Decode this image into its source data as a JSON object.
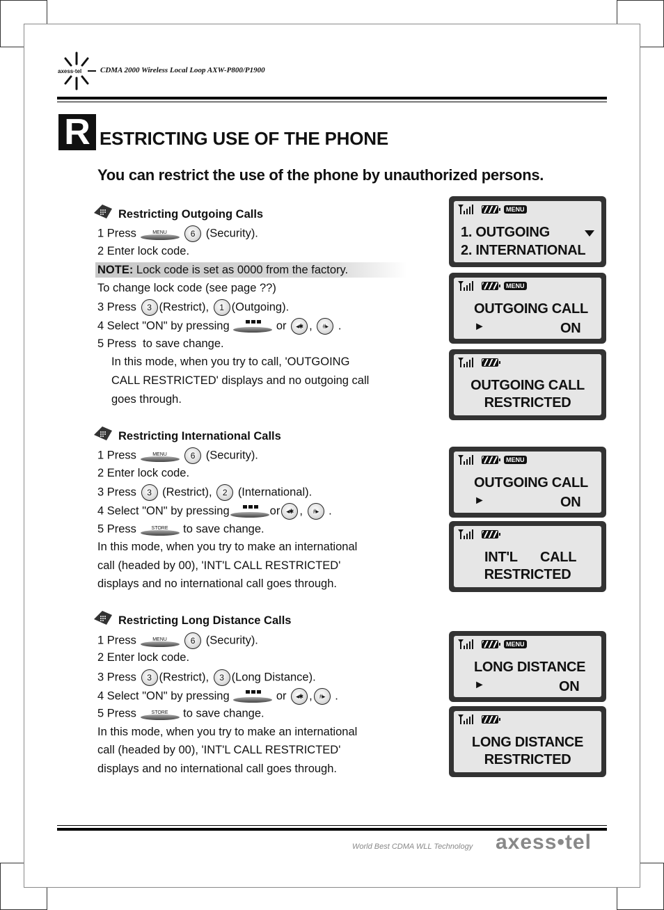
{
  "header": {
    "logo_text": "axess-tel",
    "document_title": "CDMA 2000 Wireless Local Loop AXW-P800/P1900"
  },
  "page": {
    "drop_cap": "R",
    "title_rest": "ESTRICTING USE OF THE PHONE",
    "subtitle": "You can restrict the use of the phone by unauthorized persons."
  },
  "sections": [
    {
      "title": "Restricting Outgoing Calls",
      "step1": {
        "prefix": "1 Press",
        "key_label": "MENU",
        "digit": "6",
        "suffix": "(Security)."
      },
      "step2": "2 Enter lock code.",
      "note": {
        "label": "NOTE:",
        "text": " Lock code is set as 0000 from the factory."
      },
      "change_code": "To change lock code (see page ??)",
      "step3": {
        "prefix": "3 Press",
        "digit1": "3",
        "mid": "(Restrict),",
        "digit2": "1",
        "suffix": "(Outgoing)."
      },
      "step4": {
        "prefix": "4 Select \"ON\" by pressing",
        "or": "or",
        "comma": ",",
        "left_key": "◂✱",
        "right_key": "#▸",
        "end": "."
      },
      "step5": {
        "prefix": "5 Press",
        "key_label": "",
        "suffix": "to save change."
      },
      "desc": [
        "In this mode, when you try to call, 'OUTGOING",
        "CALL RESTRICTED' displays and no outgoing call",
        "goes through."
      ]
    },
    {
      "title": "Restricting International Calls",
      "step1": {
        "prefix": "1 Press",
        "key_label": "MENU",
        "digit": "6",
        "suffix": "(Security)."
      },
      "step2": "2 Enter lock code.",
      "step3": {
        "prefix": "3 Press",
        "digit1": "3",
        "mid": "(Restrict),",
        "digit2": "2",
        "suffix": "(International)."
      },
      "step4": {
        "prefix": "4 Select \"ON\" by pressing",
        "or": "or",
        "comma": ",",
        "left_key": "◂✱",
        "right_key": "#▸",
        "end": "."
      },
      "step5": {
        "prefix": "5 Press",
        "key_label": "STORE",
        "suffix": "to save change."
      },
      "desc": [
        "In this mode, when you try to make an international",
        "call (headed by 00), 'INT'L CALL RESTRICTED'",
        "displays and no international call goes through."
      ]
    },
    {
      "title": "Restricting Long Distance Calls",
      "step1": {
        "prefix": "1 Press",
        "key_label": "MENU",
        "digit": "6",
        "suffix": "(Security)."
      },
      "step2": "2 Enter lock code.",
      "step3": {
        "prefix": "3 Press",
        "digit1": "3",
        "mid": "(Restrict),",
        "digit2": "3",
        "suffix": "(Long Distance)."
      },
      "step4": {
        "prefix": "4 Select \"ON\" by pressing",
        "or": "or",
        "comma": ",",
        "left_key": "◂✱",
        "right_key": "#▸",
        "end": "."
      },
      "step5": {
        "prefix": "5 Press",
        "key_label": "STORE",
        "suffix": "to save change."
      },
      "desc": [
        "In this mode, when you try to make an international",
        "call (headed by 00), 'INT'L CALL RESTRICTED'",
        "displays and no international call goes through."
      ]
    }
  ],
  "screens": [
    {
      "menu_badge": "MENU",
      "line1": "1.  OUTGOING",
      "line2": "2.  INTERNATIONAL",
      "scroll_icon": "triangle-down"
    },
    {
      "menu_badge": "MENU",
      "line1": "OUTGOING CALL",
      "arrow": "►",
      "value": "ON"
    },
    {
      "line1": "OUTGOING CALL",
      "line2": "RESTRICTED"
    },
    {
      "menu_badge": "MENU",
      "line1": "OUTGOING CALL",
      "arrow": "►",
      "value": "ON"
    },
    {
      "line1a": "INT'L",
      "line1b": "CALL",
      "line2": "RESTRICTED"
    },
    {
      "menu_badge": "MENU",
      "line1": "LONG DISTANCE",
      "arrow": "►",
      "value": "ON"
    },
    {
      "line1": "LONG DISTANCE",
      "line2": "RESTRICTED"
    }
  ],
  "footer": {
    "slogan": "World Best CDMA WLL Technology",
    "brand": "axess•tel"
  }
}
